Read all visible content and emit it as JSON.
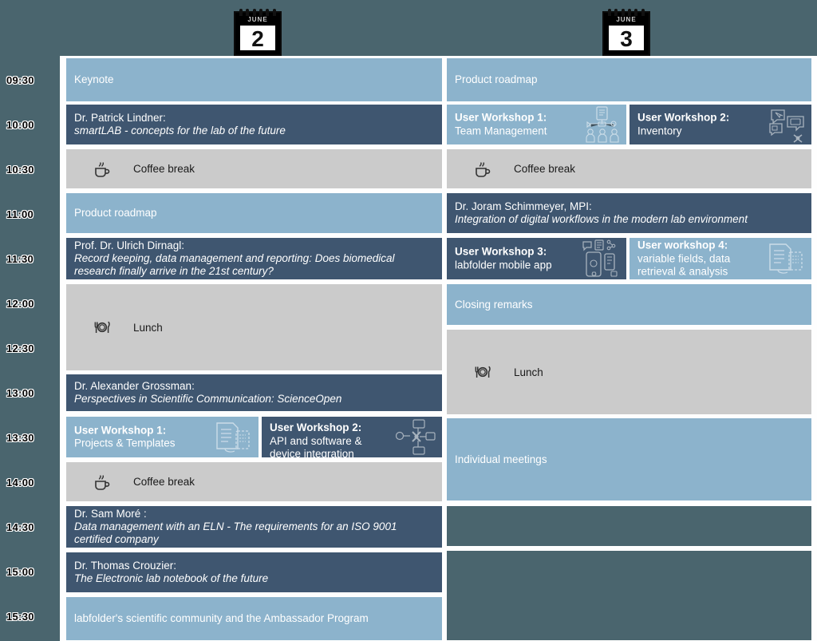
{
  "meta": {
    "background_color": "#4a656e",
    "light_block_color": "#8cb3cc",
    "dark_block_color": "#3f5670",
    "break_block_color": "#cbcbcb"
  },
  "time_axis": {
    "labels": [
      "09:30",
      "10:00",
      "10:30",
      "11:00",
      "11:30",
      "12:00",
      "12:30",
      "13:00",
      "13:30",
      "14:00",
      "14:30",
      "15:00",
      "15:30"
    ]
  },
  "days": [
    {
      "month": "JUNE",
      "number": "2",
      "icon": "calendar-icon"
    },
    {
      "month": "JUNE",
      "number": "3",
      "icon": "calendar-icon"
    }
  ],
  "day2": {
    "sessions": [
      {
        "id": "keynote",
        "style": "light",
        "label": "Keynote"
      },
      {
        "id": "lindner",
        "style": "dark",
        "speaker": "Dr. Patrick Lindner:",
        "talk": "smartLAB - concepts for the lab of the future"
      },
      {
        "id": "coffee-1",
        "style": "grey",
        "label": "Coffee break",
        "icon": "coffee-cup-icon"
      },
      {
        "id": "product-roadmap",
        "style": "light",
        "label": "Product roadmap"
      },
      {
        "id": "dirnagl",
        "style": "dark",
        "speaker": "Prof. Dr. Ulrich Dirnagl:",
        "talk": "Record keeping, data management and reporting: Does biomedical  research finally arrive in the 21st century?"
      },
      {
        "id": "lunch-1",
        "style": "grey",
        "label": "Lunch",
        "icon": "cutlery-icon"
      },
      {
        "id": "grossman",
        "style": "dark",
        "speaker": "Dr. Alexander Grossman:",
        "talk": "Perspectives in Scientific Communication: ScienceOpen"
      },
      {
        "id": "workshop-1",
        "style": "light",
        "title": "User Workshop 1:",
        "subtitle": "Projects & Templates",
        "icon": "documents-icon"
      },
      {
        "id": "workshop-2",
        "style": "dark",
        "title": "User Workshop 2:",
        "subtitle": "API and software & device integration",
        "icon": "network-nodes-icon"
      },
      {
        "id": "coffee-2",
        "style": "grey",
        "label": "Coffee break",
        "icon": "coffee-cup-icon"
      },
      {
        "id": "more",
        "style": "dark",
        "speaker": "Dr. Sam Moré :",
        "talk": "Data management with an ELN - The requirements for an ISO 9001 certified company"
      },
      {
        "id": "crouzier",
        "style": "dark",
        "speaker": "Dr. Thomas Crouzier:",
        "talk": "The Electronic lab notebook of the future"
      },
      {
        "id": "ambassador",
        "style": "light",
        "label": "labfolder's scientific community and the Ambassador Program"
      }
    ]
  },
  "day3": {
    "sessions": [
      {
        "id": "product-roadmap-3",
        "style": "light",
        "label": "Product roadmap"
      },
      {
        "id": "workshop-1-3",
        "style": "light",
        "title": "User Workshop 1:",
        "subtitle": "Team Management",
        "icon": "team-icon"
      },
      {
        "id": "workshop-2-3",
        "style": "dark",
        "title": "User Workshop 2:",
        "subtitle": "Inventory",
        "icon": "speech-bubbles-icon"
      },
      {
        "id": "coffee-3",
        "style": "grey",
        "label": "Coffee break",
        "icon": "coffee-cup-icon"
      },
      {
        "id": "schimmeyer",
        "style": "dark",
        "speaker": "Dr. Joram Schimmeyer, MPI:",
        "talk": "Integration of digital workflows in the modern lab environment"
      },
      {
        "id": "workshop-3",
        "style": "dark",
        "title": "User Workshop 3:",
        "subtitle": "labfolder mobile app",
        "icon": "mobile-app-icon"
      },
      {
        "id": "workshop-4",
        "style": "light",
        "title": "User workshop 4:",
        "subtitle": "variable fields, data retrieval & analysis",
        "icon": "documents-icon"
      },
      {
        "id": "closing-remarks",
        "style": "light",
        "label": "Closing remarks"
      },
      {
        "id": "lunch-2",
        "style": "grey",
        "label": "Lunch",
        "icon": "cutlery-icon"
      },
      {
        "id": "individual",
        "style": "light",
        "label": "Individual meetings"
      },
      {
        "id": "empty-1",
        "style": "empty",
        "label": ""
      },
      {
        "id": "empty-2",
        "style": "empty",
        "label": ""
      }
    ]
  }
}
